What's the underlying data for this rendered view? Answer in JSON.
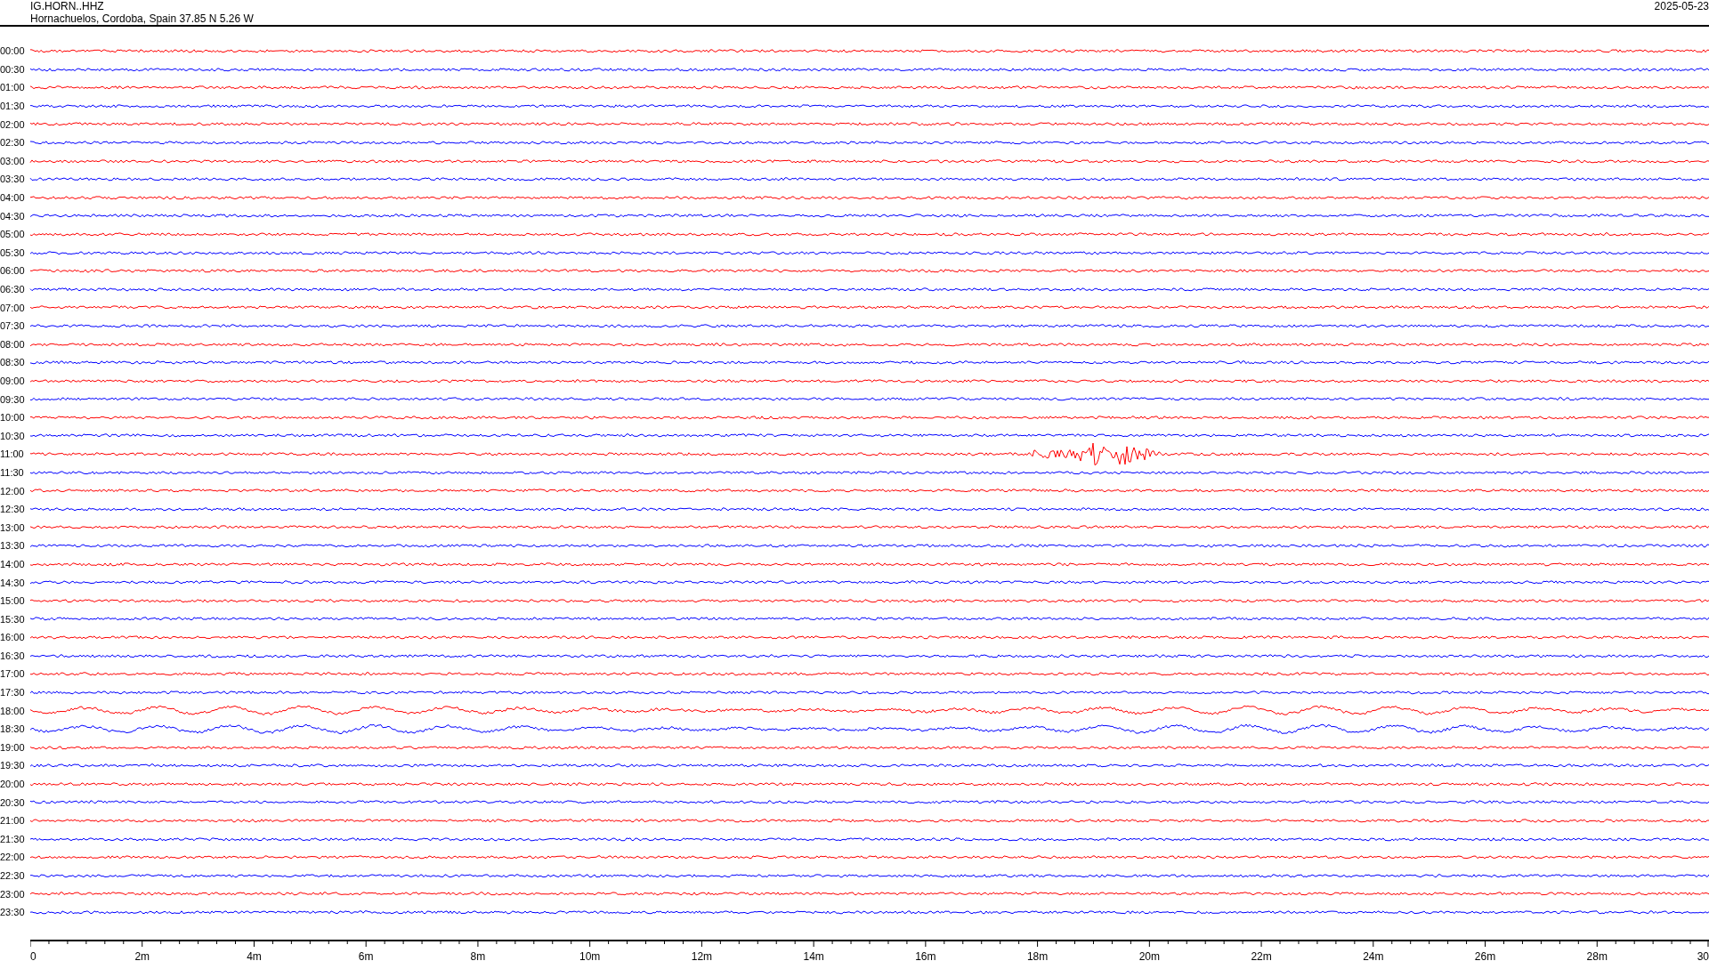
{
  "header": {
    "station": "IG.HORN..HHZ",
    "location": "Hornachuelos, Cordoba, Spain  37.85 N 5.26 W",
    "date": "2025-05-23"
  },
  "rows": [
    {
      "label": "00:00",
      "color": "#ff0000",
      "kind": "quiet"
    },
    {
      "label": "00:30",
      "color": "#0000ff",
      "kind": "quiet"
    },
    {
      "label": "01:00",
      "color": "#ff0000",
      "kind": "quiet"
    },
    {
      "label": "01:30",
      "color": "#0000ff",
      "kind": "quiet"
    },
    {
      "label": "02:00",
      "color": "#ff0000",
      "kind": "quiet"
    },
    {
      "label": "02:30",
      "color": "#0000ff",
      "kind": "quiet"
    },
    {
      "label": "03:00",
      "color": "#ff0000",
      "kind": "quiet"
    },
    {
      "label": "03:30",
      "color": "#0000ff",
      "kind": "quiet"
    },
    {
      "label": "04:00",
      "color": "#ff0000",
      "kind": "quiet"
    },
    {
      "label": "04:30",
      "color": "#0000ff",
      "kind": "quiet"
    },
    {
      "label": "05:00",
      "color": "#ff0000",
      "kind": "quiet"
    },
    {
      "label": "05:30",
      "color": "#0000ff",
      "kind": "quiet"
    },
    {
      "label": "06:00",
      "color": "#ff0000",
      "kind": "quiet"
    },
    {
      "label": "06:30",
      "color": "#0000ff",
      "kind": "quiet"
    },
    {
      "label": "07:00",
      "color": "#ff0000",
      "kind": "quiet"
    },
    {
      "label": "07:30",
      "color": "#0000ff",
      "kind": "quiet"
    },
    {
      "label": "08:00",
      "color": "#ff0000",
      "kind": "quiet"
    },
    {
      "label": "08:30",
      "color": "#0000ff",
      "kind": "quiet"
    },
    {
      "label": "09:00",
      "color": "#ff0000",
      "kind": "quiet"
    },
    {
      "label": "09:30",
      "color": "#0000ff",
      "kind": "quiet"
    },
    {
      "label": "10:00",
      "color": "#ff0000",
      "kind": "quiet"
    },
    {
      "label": "10:30",
      "color": "#0000ff",
      "kind": "quiet"
    },
    {
      "label": "11:00",
      "color": "#ff0000",
      "kind": "event"
    },
    {
      "label": "11:30",
      "color": "#0000ff",
      "kind": "quiet"
    },
    {
      "label": "12:00",
      "color": "#ff0000",
      "kind": "quiet"
    },
    {
      "label": "12:30",
      "color": "#0000ff",
      "kind": "quiet"
    },
    {
      "label": "13:00",
      "color": "#ff0000",
      "kind": "quiet"
    },
    {
      "label": "13:30",
      "color": "#0000ff",
      "kind": "quiet"
    },
    {
      "label": "14:00",
      "color": "#ff0000",
      "kind": "quiet"
    },
    {
      "label": "14:30",
      "color": "#0000ff",
      "kind": "quiet"
    },
    {
      "label": "15:00",
      "color": "#ff0000",
      "kind": "quiet"
    },
    {
      "label": "15:30",
      "color": "#0000ff",
      "kind": "quiet"
    },
    {
      "label": "16:00",
      "color": "#ff0000",
      "kind": "quiet"
    },
    {
      "label": "16:30",
      "color": "#0000ff",
      "kind": "quiet"
    },
    {
      "label": "17:00",
      "color": "#ff0000",
      "kind": "quiet"
    },
    {
      "label": "17:30",
      "color": "#0000ff",
      "kind": "quiet"
    },
    {
      "label": "18:00",
      "color": "#ff0000",
      "kind": "swell"
    },
    {
      "label": "18:30",
      "color": "#0000ff",
      "kind": "swell"
    },
    {
      "label": "19:00",
      "color": "#ff0000",
      "kind": "quiet"
    },
    {
      "label": "19:30",
      "color": "#0000ff",
      "kind": "quiet"
    },
    {
      "label": "20:00",
      "color": "#ff0000",
      "kind": "quiet"
    },
    {
      "label": "20:30",
      "color": "#0000ff",
      "kind": "quiet"
    },
    {
      "label": "21:00",
      "color": "#ff0000",
      "kind": "quiet"
    },
    {
      "label": "21:30",
      "color": "#0000ff",
      "kind": "quiet"
    },
    {
      "label": "22:00",
      "color": "#ff0000",
      "kind": "quiet"
    },
    {
      "label": "22:30",
      "color": "#0000ff",
      "kind": "quiet"
    },
    {
      "label": "23:00",
      "color": "#ff0000",
      "kind": "quiet"
    },
    {
      "label": "23:30",
      "color": "#0000ff",
      "kind": "quiet"
    }
  ],
  "time_axis": {
    "ticks": [
      "0",
      "2m",
      "4m",
      "6m",
      "8m",
      "10m",
      "12m",
      "14m",
      "16m",
      "18m",
      "20m",
      "22m",
      "24m",
      "26m",
      "28m",
      "30"
    ]
  }
}
